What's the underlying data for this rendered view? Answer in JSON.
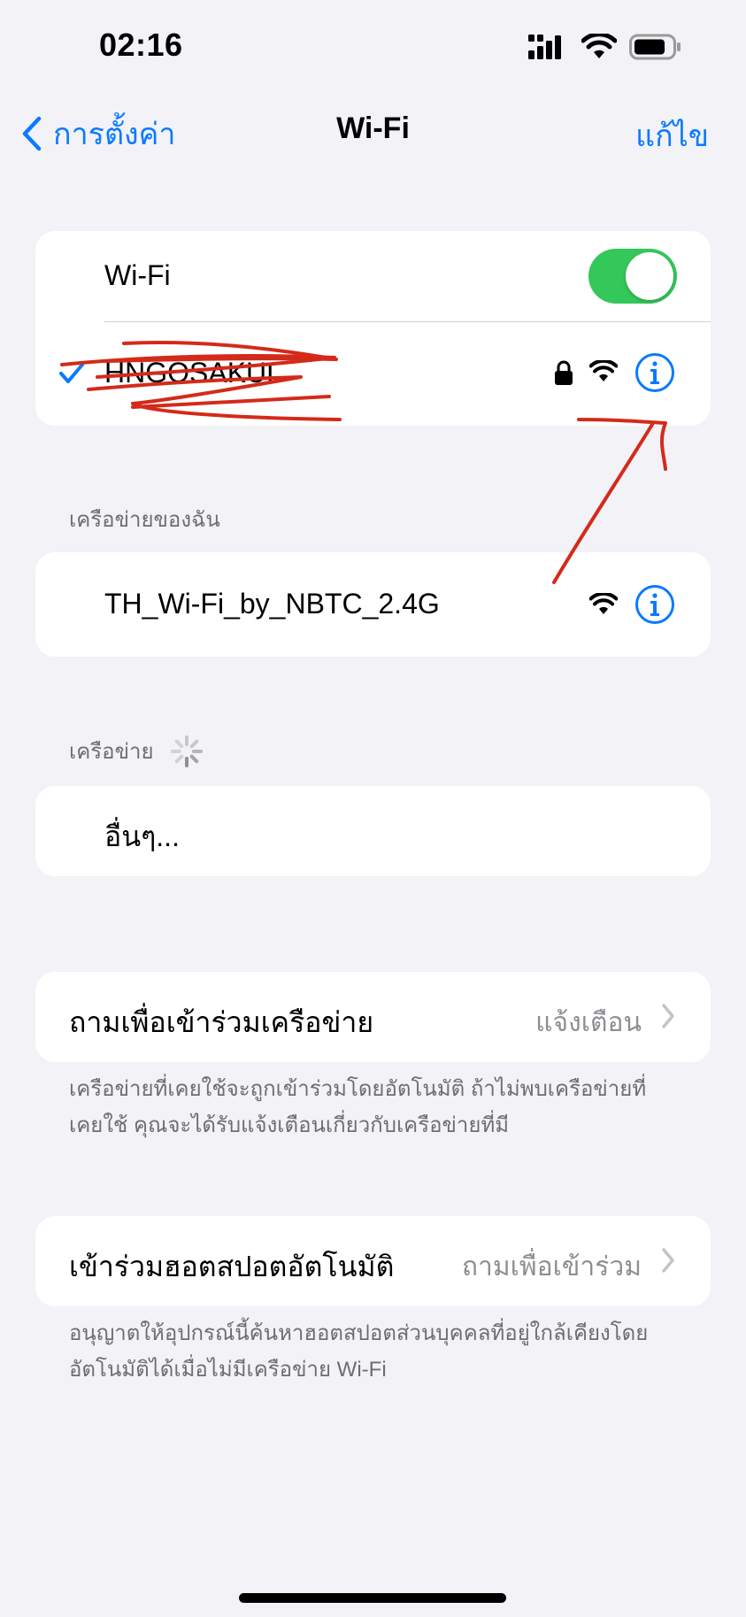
{
  "status_bar": {
    "time": "02:16"
  },
  "nav": {
    "back_label": "การตั้งค่า",
    "title": "Wi-Fi",
    "edit_label": "แก้ไข"
  },
  "wifi_toggle": {
    "label": "Wi-Fi",
    "on": true
  },
  "connected_network": {
    "name": "HNGOSAKUL"
  },
  "my_networks": {
    "header": "เครือข่ายของฉัน",
    "items": [
      {
        "name": "TH_Wi-Fi_by_NBTC_2.4G"
      }
    ]
  },
  "networks": {
    "header": "เครือข่าย",
    "other_label": "อื่นๆ..."
  },
  "ask_to_join": {
    "label": "ถามเพื่อเข้าร่วมเครือข่าย",
    "value": "แจ้งเตือน",
    "footer": "เครือข่ายที่เคยใช้จะถูกเข้าร่วมโดยอัตโนมัติ ถ้าไม่พบเครือข่ายที่เคยใช้ คุณจะได้รับแจ้งเตือนเกี่ยวกับเครือข่ายที่มี"
  },
  "auto_join_hotspot": {
    "label": "เข้าร่วมฮอตสปอตอัตโนมัติ",
    "value": "ถามเพื่อเข้าร่วม",
    "footer": "อนุญาตให้อุปกรณ์นี้ค้นหาฮอตสปอตส่วนบุคคลที่อยู่ใกล้เคียงโดยอัตโนมัติได้เมื่อไม่มีเครือข่าย Wi-Fi"
  },
  "colors": {
    "accent": "#0a7aff",
    "toggle_on": "#34c759",
    "annotation": "#d42a1a",
    "background": "#f2f2f7"
  },
  "icons": [
    "chevron-left-icon",
    "checkmark-icon",
    "lock-icon",
    "wifi-icon",
    "info-icon",
    "chevron-right-icon",
    "cellular-icon",
    "battery-icon",
    "spinner-icon"
  ]
}
